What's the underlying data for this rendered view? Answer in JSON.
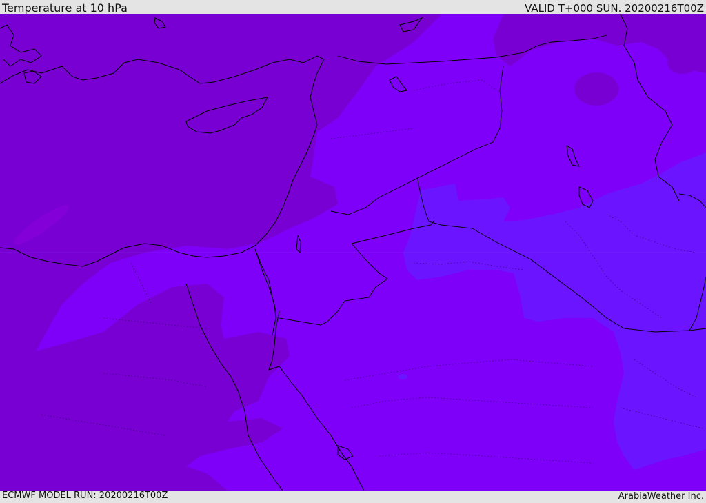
{
  "header": {
    "title": "Temperature at 10 hPa",
    "valid_time": "VALID T+000 SUN. 20200216T00Z"
  },
  "footer": {
    "model_run": "ECMWF MODEL RUN: 20200216T00Z",
    "credit": "ArabiaWeather Inc."
  },
  "map": {
    "fields": {
      "deep_violet": "#7800d2",
      "violet": "#7f00f8",
      "purple": "#8000ff",
      "blue_violet": "#6a14ff"
    },
    "coastline_color": "#000000",
    "border_style": "dotted"
  }
}
